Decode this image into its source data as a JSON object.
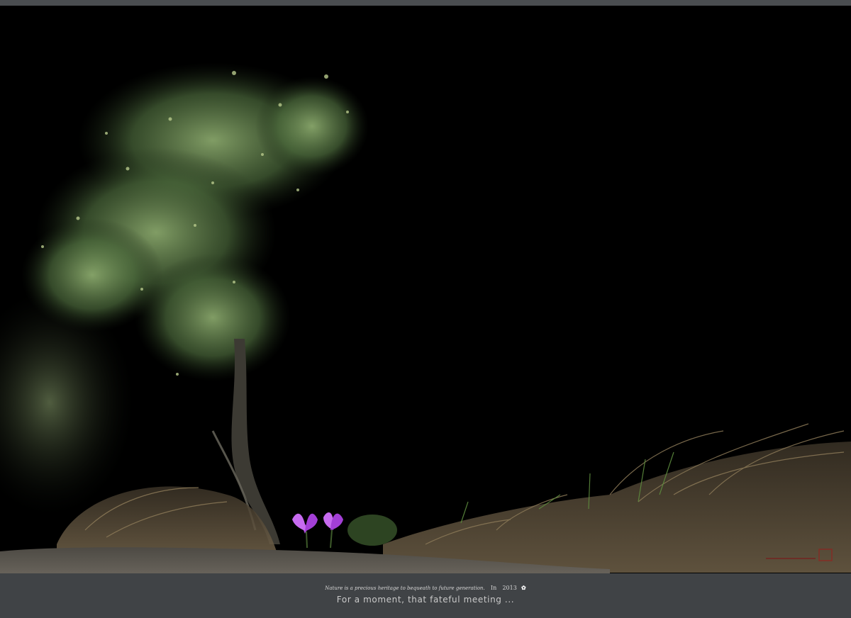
{
  "photo": {
    "subject": "photograph"
  },
  "footer": {
    "credit_text": "Nature is a precious heritage to bequeath to future generation.",
    "credit_in": "In",
    "credit_year": "2013",
    "title": "For a moment, that fateful meeting ..."
  },
  "colors": {
    "frame": "#3f4245",
    "photo_background": "#000000",
    "foliage": "#6f8f5a",
    "flower": "#b04fe0",
    "ground": "#5e5a52",
    "grass": "#7a6a4d",
    "caption_text": "#c9c9c9"
  }
}
